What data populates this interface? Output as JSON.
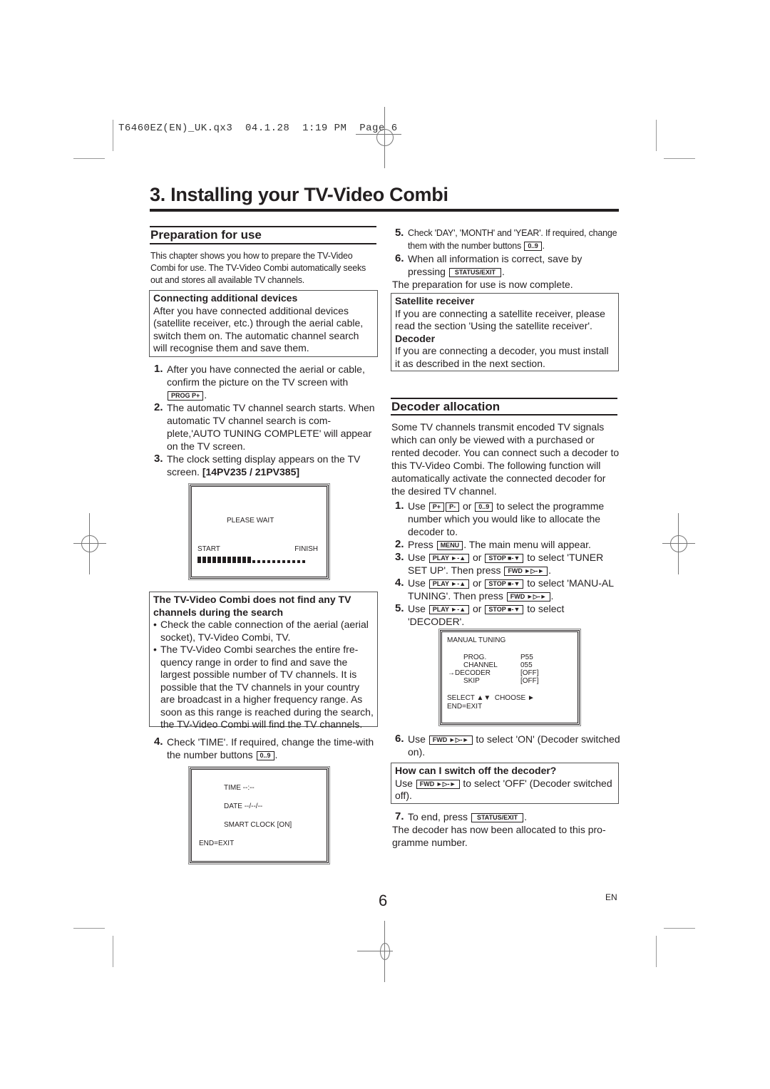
{
  "slug": "T6460EZ(EN)_UK.qx3  04.1.28  1:19 PM  Page 6",
  "chapter_title": "3. Installing your TV-Video Combi",
  "prep": {
    "heading": "Preparation for use",
    "intro": "This chapter shows you how to prepare the TV-Video Combi for use. The TV-Video Combi automatically seeks out and stores all available TV channels.",
    "note_title": "Connecting additional devices",
    "note_body": "After you have connected additional devices (satellite receiver, etc.) through the aerial cable, switch them on. The automatic channel search will recognise them and save them.",
    "step1_num": "1.",
    "step1_text": "After you have connected the aerial or cable, confirm the picture on the TV screen with",
    "step1_key": "PROG P+",
    "step2_num": "2.",
    "step2_text": "The automatic TV channel search starts. When automatic TV channel search is com-plete,'AUTO TUNING COMPLETE' will appear on the TV screen.",
    "step3_num": "3.",
    "step3_text": "The clock setting display appears on the TV screen.",
    "step3_models": "[14PV235 / 21PV385]",
    "screen1": {
      "message": "PLEASE WAIT",
      "start": "START",
      "finish": "FINISH",
      "progress_filled": 11,
      "progress_total": 22
    },
    "trouble_title": "The TV-Video Combi does not find any TV channels during the search",
    "trouble_bullets": [
      "Check the cable connection of the aerial (aerial socket), TV-Video Combi, TV.",
      "The TV-Video Combi searches the entire fre-quency range in order to find and save the largest possible number of TV channels. It is possible that the TV channels in your country are broadcast in a higher frequency range. As soon as this range is reached during the search, the TV-Video Combi will find the TV channels."
    ],
    "step4_num": "4.",
    "step4_text": "Check 'TIME'. If required, change the time-with the number buttons",
    "step4_key": "0..9",
    "screen2": {
      "time": "TIME --:--",
      "date": "DATE --/--/--",
      "smart_clock": "SMART CLOCK [ON]",
      "end": "END=EXIT"
    },
    "step5_num": "5.",
    "step5_text": "Check 'DAY', 'MONTH' and 'YEAR'. If required, change them with the number buttons",
    "step5_key": "0..9",
    "step6_num": "6.",
    "step6_text": "When all information is correct, save by pressing",
    "step6_key": "STATUS/EXIT",
    "complete": "The preparation for use is now complete.",
    "sat_title": "Satellite receiver",
    "sat_body": "If you are connecting a satellite receiver, please read the section 'Using the satellite receiver'.",
    "dec_title": "Decoder",
    "dec_body": "If you are connecting a decoder, you must install it as described in the next section."
  },
  "decoder": {
    "heading": "Decoder allocation",
    "intro": "Some TV channels transmit encoded TV signals which can only be viewed with a purchased or rented decoder. You can connect such a decoder to this TV-Video Combi. The following function will automatically activate the connected decoder for the desired TV channel.",
    "keys": {
      "p_plus": "P+",
      "p_minus": "P-",
      "num": "0..9",
      "menu": "MENU",
      "play": "PLAY ►-▲",
      "stop": "STOP ■-▼",
      "fwd": "FWD ►▷-►",
      "status": "STATUS/EXIT"
    },
    "s1_num": "1.",
    "s1_a": "Use",
    "s1_or": "or",
    "s1_b": "to select the programme number which you would like to allocate the decoder to.",
    "s2_num": "2.",
    "s2_a": "Press",
    "s2_b": ". The main menu will appear.",
    "s3_num": "3.",
    "s3_a": "Use",
    "s3_or": "or",
    "s3_b": "to select 'TUNER SET UP'. Then press",
    "s4_num": "4.",
    "s4_a": "Use",
    "s4_or": "or",
    "s4_b": "to select 'MANU-AL TUNING'. Then press",
    "s5_num": "5.",
    "s5_a": "Use",
    "s5_or": "or",
    "s5_b": "to select 'DECODER'.",
    "screen": {
      "title": "MANUAL TUNING",
      "rows": [
        {
          "label": "PROG.",
          "value": "P55",
          "selected": false
        },
        {
          "label": "CHANNEL",
          "value": "055",
          "selected": false
        },
        {
          "label": "→DECODER",
          "value": "[OFF]",
          "selected": true
        },
        {
          "label": "SKIP",
          "value": "[OFF]",
          "selected": false
        }
      ],
      "select": "SELECT ▲▼  CHOOSE ►",
      "end": "END=EXIT"
    },
    "s6_num": "6.",
    "s6_a": "Use",
    "s6_b": "to select 'ON' (Decoder switched on).",
    "off_title": "How can I switch off the decoder?",
    "off_a": "Use",
    "off_b": "to select 'OFF' (Decoder switched off).",
    "s7_num": "7.",
    "s7_a": "To end, press",
    "final": "The decoder has now been allocated to this pro-gramme number."
  },
  "footer": {
    "page_number": "6",
    "language": "EN"
  }
}
